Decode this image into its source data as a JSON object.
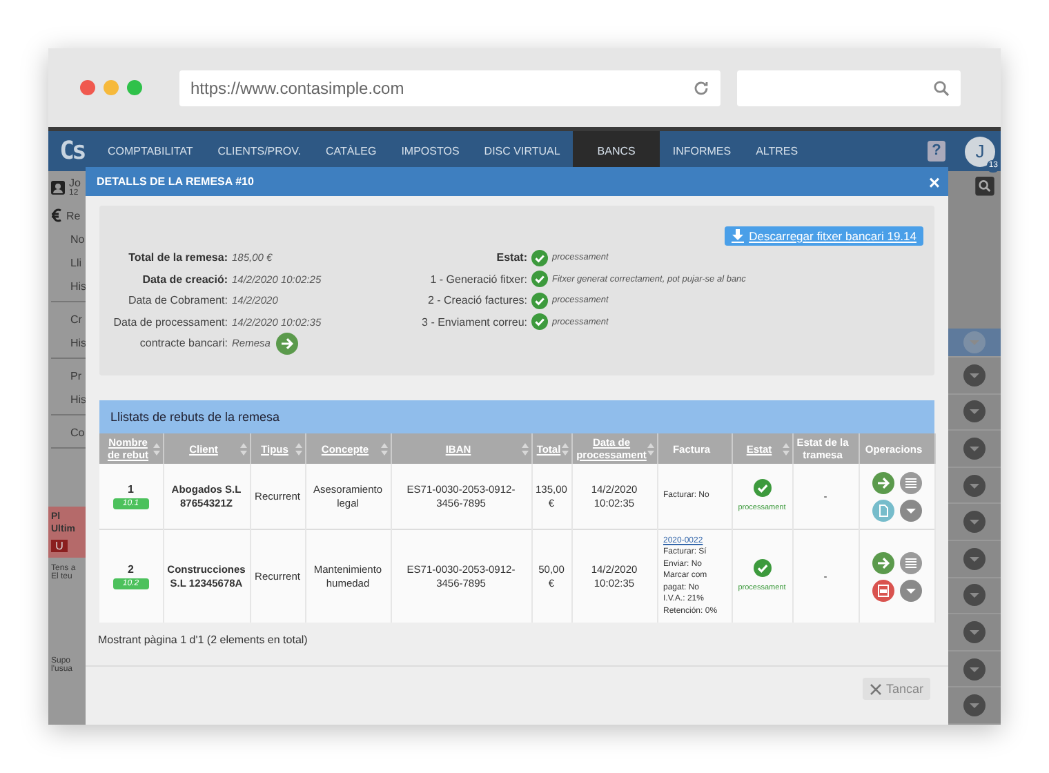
{
  "browser": {
    "url": "https://www.contasimple.com"
  },
  "nav": {
    "logo": "Cs",
    "items": [
      {
        "label": "COMPTABILITAT",
        "selected": false
      },
      {
        "label": "CLIENTS/PROV.",
        "selected": false
      },
      {
        "label": "CATÀLEG",
        "selected": false
      },
      {
        "label": "IMPOSTOS",
        "selected": false
      },
      {
        "label": "DISC VIRTUAL",
        "selected": false
      },
      {
        "label": "BANCS",
        "selected": true
      },
      {
        "label": "INFORMES",
        "selected": false
      },
      {
        "label": "ALTRES",
        "selected": false
      }
    ],
    "help": "?",
    "avatar": "J",
    "avatar_badge": "13"
  },
  "background": {
    "user_name": "Jo",
    "user_sub": "12",
    "section": "Re",
    "groups": [
      [
        "No",
        "Lli",
        "His"
      ],
      [
        "Cr",
        "His"
      ],
      [
        "Pr",
        "His"
      ],
      [
        "Co"
      ]
    ],
    "promo": [
      "Pl",
      "Ultim"
    ],
    "promo_button": "U",
    "promo_text": [
      "Tens a",
      "El teu"
    ],
    "footer": [
      "Supo",
      "l'usua"
    ]
  },
  "modal": {
    "title": "DETALLS DE LA REMESA #10",
    "close": "×",
    "download": "Descarregar fitxer bancari 19.14",
    "details": [
      {
        "label": "Total de la remesa:",
        "value": "185,00 €",
        "emphasis": true,
        "kind": "text"
      },
      {
        "label": "Data de creació:",
        "value": "14/2/2020 10:02:25",
        "emphasis": true,
        "kind": "text"
      },
      {
        "label": "Data de Cobrament:",
        "value": "14/2/2020",
        "emphasis": false,
        "kind": "text"
      },
      {
        "label": "Data de processament:",
        "value": "14/2/2020 10:02:35",
        "emphasis": false,
        "kind": "text"
      },
      {
        "label": "contracte bancari:",
        "value": "Remesa",
        "emphasis": false,
        "kind": "link"
      }
    ],
    "statuses": [
      {
        "label": "Estat:",
        "value": "processament",
        "emphasis": true
      },
      {
        "label": "1 - Generació fitxer:",
        "value": "Fitxer generat correctament, pot pujar-se al banc",
        "emphasis": false
      },
      {
        "label": "2 - Creació factures:",
        "value": "processament",
        "emphasis": false
      },
      {
        "label": "3 - Enviament correu:",
        "value": "processament",
        "emphasis": false
      }
    ],
    "table_title": "Llistats de rebuts de la remesa",
    "columns": [
      {
        "label": "Nombre de rebut",
        "sortable": true
      },
      {
        "label": "Client",
        "sortable": true
      },
      {
        "label": "Tipus",
        "sortable": true
      },
      {
        "label": "Concepte",
        "sortable": true
      },
      {
        "label": "IBAN",
        "sortable": true
      },
      {
        "label": "Total",
        "sortable": true
      },
      {
        "label": "Data de processament",
        "sortable": true
      },
      {
        "label": "Factura",
        "sortable": false
      },
      {
        "label": "Estat",
        "sortable": true
      },
      {
        "label": "Estat de la tramesa",
        "sortable": false
      },
      {
        "label": "Operacions",
        "sortable": false
      }
    ],
    "rows": [
      {
        "number": "1",
        "badge": "10.1",
        "client": "Abogados S.L 87654321Z",
        "type": "Recurrent",
        "concept": "Asesoramiento legal",
        "iban": "ES71-0030-2053-0912-3456-7895",
        "total": "135,00 €",
        "date": "14/2/2020 10:02:35",
        "invoice_link": null,
        "invoice_lines": [
          "Facturar: No"
        ],
        "status": "processament",
        "delivery": "-",
        "ops": [
          {
            "kind": "arrow"
          },
          {
            "kind": "menu"
          },
          {
            "kind": "doc"
          },
          {
            "kind": "more"
          }
        ]
      },
      {
        "number": "2",
        "badge": "10.2",
        "client": "Construcciones S.L 12345678A",
        "type": "Recurrent",
        "concept": "Mantenimiento humedad",
        "iban": "ES71-0030-2053-0912-3456-7895",
        "total": "50,00 €",
        "date": "14/2/2020 10:02:35",
        "invoice_link": "2020-0022",
        "invoice_lines": [
          "Facturar: Sí",
          "Enviar: No",
          "Marcar com pagat: No",
          "I.V.A.: 21%",
          "Retención: 0%"
        ],
        "status": "processament",
        "delivery": "-",
        "ops": [
          {
            "kind": "arrow"
          },
          {
            "kind": "menu"
          },
          {
            "kind": "pdf"
          },
          {
            "kind": "more"
          }
        ]
      }
    ],
    "pagination": "Mostrant pàgina 1 d'1 (2 elements en total)",
    "close_button": "Tancar"
  }
}
